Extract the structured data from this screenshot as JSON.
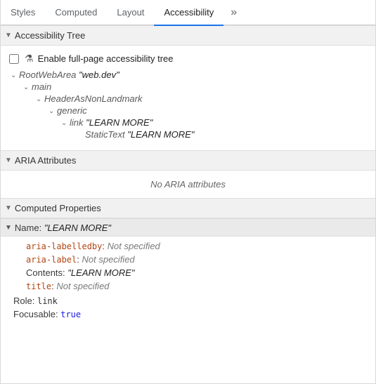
{
  "tabs": [
    "Styles",
    "Computed",
    "Layout",
    "Accessibility"
  ],
  "sections": {
    "tree": {
      "title": "Accessibility Tree",
      "enable_label": "Enable full-page accessibility tree"
    },
    "aria": {
      "title": "ARIA Attributes",
      "empty": "No ARIA attributes"
    },
    "computed": {
      "title": "Computed Properties"
    }
  },
  "tree": [
    {
      "role": "RootWebArea",
      "name": "\"web.dev\""
    },
    {
      "role": "main"
    },
    {
      "role": "HeaderAsNonLandmark"
    },
    {
      "role": "generic"
    },
    {
      "role": "link",
      "name": "\"LEARN MORE\""
    },
    {
      "role": "StaticText",
      "name": "\"LEARN MORE\""
    }
  ],
  "computed": {
    "name_label": "Name:",
    "name_value": "\"LEARN MORE\"",
    "sources": [
      {
        "attr": "aria-labelledby",
        "value": "Not specified"
      },
      {
        "attr": "aria-label",
        "value": "Not specified"
      },
      {
        "attr": "Contents",
        "value": "\"LEARN MORE\""
      },
      {
        "attr": "title",
        "value": "Not specified"
      }
    ],
    "role_label": "Role:",
    "role_value": "link",
    "focusable_label": "Focusable:",
    "focusable_value": "true"
  }
}
